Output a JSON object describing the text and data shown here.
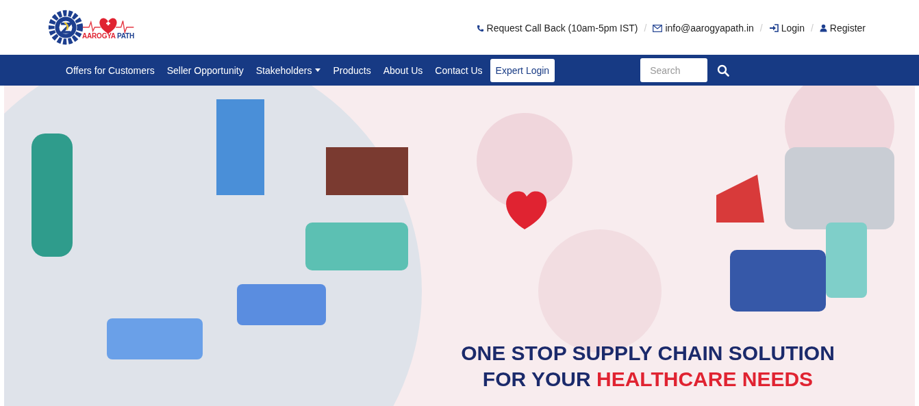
{
  "logo": {
    "word_1": "AAROGYA",
    "word_2": "PATH"
  },
  "top_links": [
    {
      "kind": "phone",
      "label": "Request Call Back (10am-5pm IST)"
    },
    {
      "kind": "mail",
      "separator": "/",
      "label": "info@aarogyapath.in"
    },
    {
      "kind": "login",
      "separator": "/",
      "label": "Login"
    },
    {
      "kind": "user",
      "separator": "/",
      "label": "Register"
    }
  ],
  "nav": {
    "items": [
      {
        "label": "Offers for Customers",
        "kind": "link"
      },
      {
        "label": "Seller Opportunity",
        "kind": "link"
      },
      {
        "label": "Stakeholders",
        "kind": "dropdown"
      },
      {
        "label": "Products",
        "kind": "link"
      },
      {
        "label": "About Us",
        "kind": "link"
      },
      {
        "label": "Contact Us",
        "kind": "link"
      },
      {
        "label": "Expert Login",
        "kind": "button"
      }
    ],
    "search": {
      "placeholder": "Search"
    }
  },
  "banner": {
    "headline_line_1": "ONE STOP SUPPLY CHAIN SOLUTION",
    "headline_line_2": "FOR YOUR",
    "headline_highlight": "HEALTHCARE NEEDS"
  }
}
